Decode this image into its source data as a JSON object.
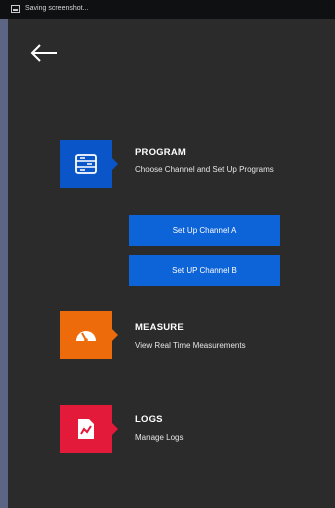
{
  "status_bar": {
    "text": "Saving screenshot...",
    "icon": "screenshot-icon"
  },
  "header": {
    "back_icon": "back-arrow-icon"
  },
  "menu": {
    "program": {
      "title": "PROGRAM",
      "description": "Choose Channel and Set Up Programs",
      "icon": "program-list-icon",
      "color": "#0a56c9"
    },
    "channel_buttons": [
      {
        "label": "Set Up Channel A"
      },
      {
        "label": "Set UP Channel B"
      }
    ],
    "measure": {
      "title": "MEASURE",
      "description": "View Real Time Measurements",
      "icon": "gauge-icon",
      "color": "#ee6b0b"
    },
    "logs": {
      "title": "LOGS",
      "description": "Manage Logs",
      "icon": "log-chart-icon",
      "color": "#e41a3a"
    }
  },
  "colors": {
    "background": "#2b2b2c",
    "button": "#0d63d8"
  }
}
